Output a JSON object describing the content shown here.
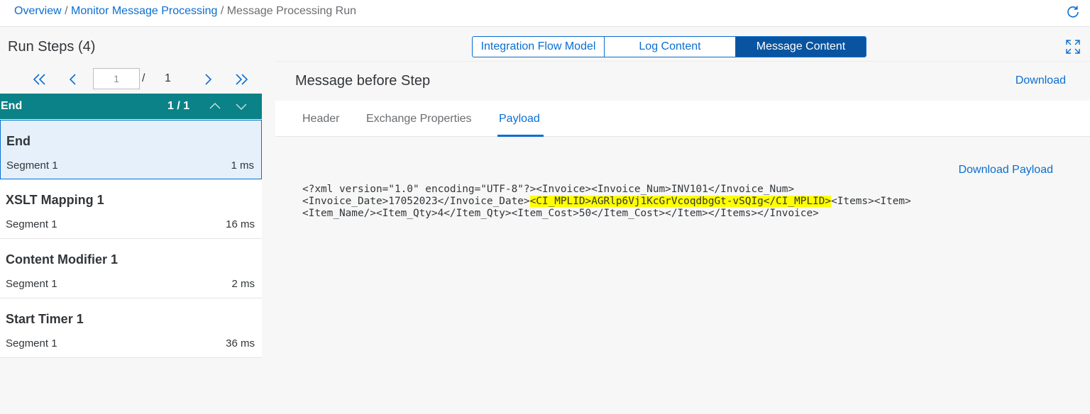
{
  "breadcrumb": {
    "items": [
      "Overview",
      "Monitor Message Processing",
      "Message Processing Run"
    ],
    "separator": "/"
  },
  "left": {
    "title": "Run Steps (4)",
    "pager": {
      "current": "1",
      "slash": "/",
      "total": "1"
    },
    "group": {
      "label": "End",
      "count": "1 / 1"
    },
    "steps": [
      {
        "name": "End",
        "segment": "Segment 1",
        "time": "1 ms",
        "selected": true
      },
      {
        "name": "XSLT Mapping 1",
        "segment": "Segment 1",
        "time": "16 ms"
      },
      {
        "name": "Content Modifier 1",
        "segment": "Segment 1",
        "time": "2 ms"
      },
      {
        "name": "Start Timer 1",
        "segment": "Segment 1",
        "time": "36 ms"
      }
    ]
  },
  "view_switch": {
    "options": [
      "Integration Flow Model",
      "Log Content",
      "Message Content"
    ],
    "selected": "Message Content"
  },
  "section": {
    "title": "Message before Step",
    "download_label": "Download"
  },
  "tabs": {
    "items": [
      "Header",
      "Exchange Properties",
      "Payload"
    ],
    "active": "Payload"
  },
  "payload": {
    "download_label": "Download Payload",
    "line1": "<?xml version=\"1.0\" encoding=\"UTF-8\"?><Invoice><Invoice_Num>INV101</Invoice_Num>",
    "line2_before": "<Invoice_Date>17052023</Invoice_Date>",
    "line2_highlight": "<CI_MPLID>AGRlp6Vj1KcGrVcoqdbgGt-vSQIg</CI_MPLID>",
    "line2_after": "<Items><Item>",
    "line3": "<Item_Name/><Item_Qty>4</Item_Qty><Item_Cost>50</Item_Cost></Item></Items></Invoice>"
  },
  "colors": {
    "link": "#0a6ed1",
    "group_header": "#0a8287",
    "active_segment": "#0854a0",
    "highlight": "#ffff00"
  },
  "icons": [
    "refresh-icon",
    "first-page-icon",
    "previous-page-icon",
    "next-page-icon",
    "last-page-icon",
    "chevron-up-icon",
    "chevron-down-icon",
    "expand-icon"
  ]
}
